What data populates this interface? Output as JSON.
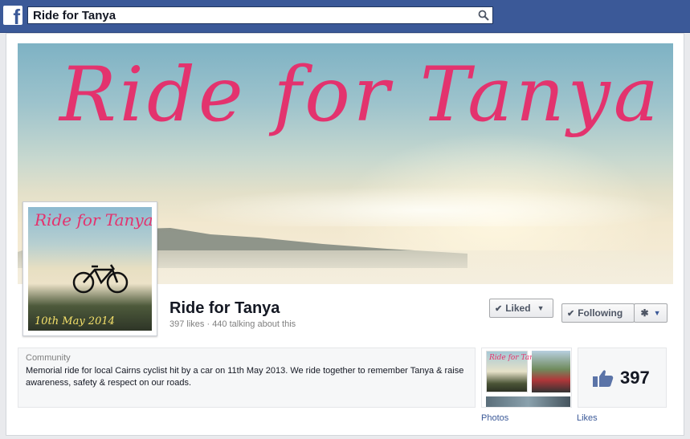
{
  "topbar": {
    "logo": "f",
    "search_value": "Ride for Tanya"
  },
  "cover": {
    "title": "Ride for Tanya"
  },
  "profile": {
    "title": "Ride for Tanya",
    "date": "10th May 2014"
  },
  "page": {
    "name": "Ride for Tanya",
    "stats": "397 likes · 440 talking about this"
  },
  "actions": {
    "liked": "Liked",
    "following": "Following"
  },
  "about": {
    "category": "Community",
    "description": "Memorial ride for local Cairns cyclist hit by a car on 11th May 2013. We ride together to remember Tanya & raise awareness, safety & respect on our roads."
  },
  "apps": {
    "photos_label": "Photos",
    "photo_thumb_title": "Ride for Tanya",
    "likes_label": "Likes",
    "likes_count": "397"
  },
  "icons": {
    "search": "search-icon",
    "check": "check-icon",
    "caret": "chevron-down-icon",
    "gear": "gear-icon",
    "thumb": "thumbs-up-icon"
  },
  "colors": {
    "brand": "#3b5998",
    "cover_text": "#e3336e"
  }
}
